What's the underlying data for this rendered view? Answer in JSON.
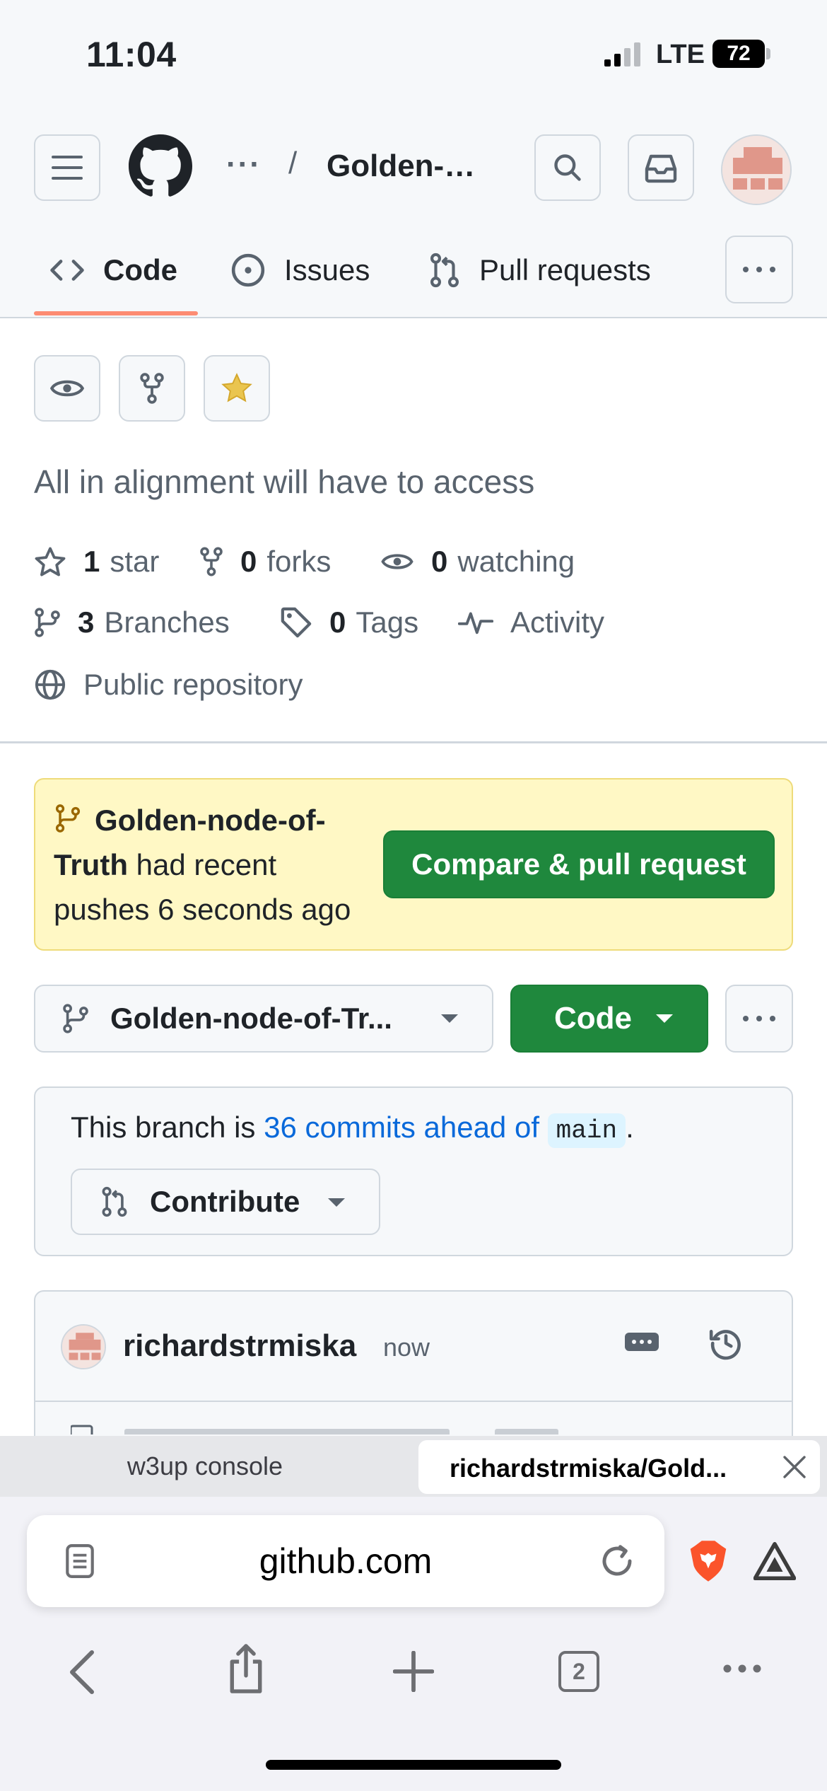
{
  "status_bar": {
    "time": "11:04",
    "network": "LTE",
    "battery": "72"
  },
  "header": {
    "breadcrumb_more": "···",
    "breadcrumb_separator": "/",
    "repo_name": "Golden-…"
  },
  "tabs": [
    {
      "label": "Code",
      "icon": "code-icon",
      "selected": true
    },
    {
      "label": "Issues",
      "icon": "issue-opened-icon"
    },
    {
      "label": "Pull requests",
      "icon": "git-pull-request-icon"
    }
  ],
  "repo": {
    "description": "All in alignment will have to access",
    "stars_count": "1",
    "stars_label": "star",
    "forks_count": "0",
    "forks_label": "forks",
    "watching_count": "0",
    "watching_label": "watching",
    "branches_count": "3",
    "branches_label": "Branches",
    "tags_count": "0",
    "tags_label": "Tags",
    "activity_label": "Activity",
    "visibility_label": "Public repository",
    "starred": true
  },
  "push_banner": {
    "branch": "Golden-node-of-Truth",
    "message": "had recent pushes 6 seconds ago",
    "button_label": "Compare & pull request"
  },
  "branch_bar": {
    "branch_label": "Golden-node-of-Tr...",
    "code_button": "Code"
  },
  "ahead": {
    "prefix": "This branch is",
    "link": "36 commits ahead of",
    "base_branch": "main",
    "suffix": ".",
    "contribute_label": "Contribute"
  },
  "commit": {
    "author": "richardstrmiska",
    "time": "now"
  },
  "browser": {
    "tabs": [
      {
        "title": "w3up console"
      },
      {
        "title": "richardstrmiska/Gold...",
        "active": true
      }
    ],
    "url": "github.com",
    "tab_count": "2"
  },
  "colors": {
    "accent_green": "#1f883d",
    "tab_underline": "#fd8c73",
    "banner_yellow": "#fff8c5",
    "link_blue": "#0969da",
    "star_yellow": "#eac54f",
    "brave_orange": "#fb542b"
  }
}
